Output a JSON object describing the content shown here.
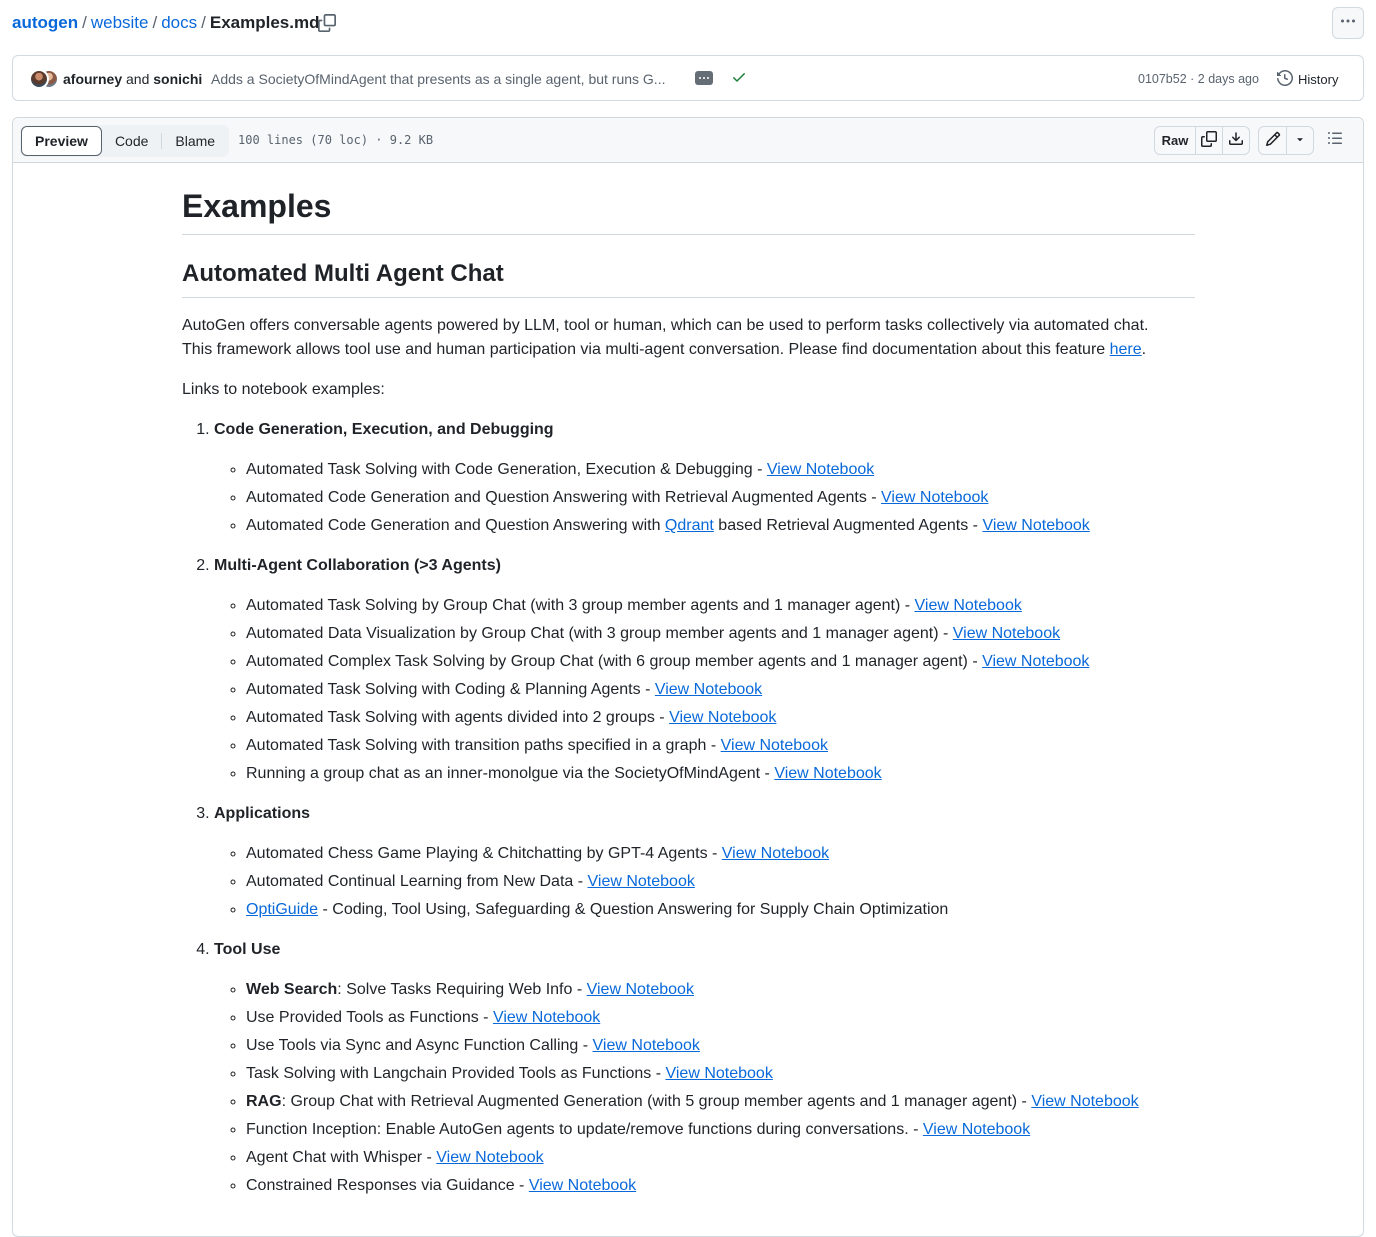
{
  "breadcrumb": {
    "root": "autogen",
    "parts": [
      "website",
      "docs"
    ],
    "separator": "/",
    "file": "Examples.md"
  },
  "icons": {
    "copy_path": "copy-icon",
    "more": "kebab-horizontal-icon",
    "check": "check-icon",
    "history": "history-icon",
    "copy_raw": "copy-icon",
    "download": "download-icon",
    "edit": "pencil-icon",
    "dropdown": "triangle-down-icon",
    "toc": "list-unordered-icon"
  },
  "colors": {
    "link": "#0969da",
    "text": "#1f2328",
    "muted": "#59636e",
    "border": "#d1d9e0",
    "success": "#1a7f37",
    "header_bg": "#f6f8fa"
  },
  "commit": {
    "author1": "afourney",
    "and": "and",
    "author2": "sonichi",
    "message": "Adds a SocietyOfMindAgent that presents as a single agent, but runs G...",
    "meta": "0107b52 · 2 days ago",
    "history_label": "History"
  },
  "file_header": {
    "tabs": [
      "Preview",
      "Code",
      "Blame"
    ],
    "active_tab": "Preview",
    "info": "100 lines (70 loc) · 9.2 KB",
    "raw_label": "Raw"
  },
  "doc": {
    "h1": "Examples",
    "h2": "Automated Multi Agent Chat",
    "intro_line1": "AutoGen offers conversable agents powered by LLM, tool or human, which can be used to perform tasks collectively via automated chat.",
    "intro_line2": "This framework allows tool use and human participation via multi-agent conversation. Please find documentation about this feature ",
    "intro_link": "here",
    "intro_end": ".",
    "links_intro": "Links to notebook examples:",
    "sections": [
      {
        "title": "Code Generation, Execution, and Debugging",
        "items": [
          {
            "text": "Automated Task Solving with Code Generation, Execution & Debugging - ",
            "link": "View Notebook"
          },
          {
            "text": "Automated Code Generation and Question Answering with Retrieval Augmented Agents - ",
            "link": "View Notebook"
          },
          {
            "pre": "Automated Code Generation and Question Answering with ",
            "inline_link": "Qdrant",
            "text": " based Retrieval Augmented Agents - ",
            "link": "View Notebook"
          }
        ]
      },
      {
        "title": "Multi-Agent Collaboration (>3 Agents)",
        "items": [
          {
            "text": "Automated Task Solving by Group Chat (with 3 group member agents and 1 manager agent) - ",
            "link": "View Notebook"
          },
          {
            "text": "Automated Data Visualization by Group Chat (with 3 group member agents and 1 manager agent) - ",
            "link": "View Notebook"
          },
          {
            "text": "Automated Complex Task Solving by Group Chat (with 6 group member agents and 1 manager agent) - ",
            "link": "View Notebook"
          },
          {
            "text": "Automated Task Solving with Coding & Planning Agents - ",
            "link": "View Notebook"
          },
          {
            "text": "Automated Task Solving with agents divided into 2 groups - ",
            "link": "View Notebook"
          },
          {
            "text": "Automated Task Solving with transition paths specified in a graph - ",
            "link": "View Notebook"
          },
          {
            "text": "Running a group chat as an inner-monolgue via the SocietyOfMindAgent - ",
            "link": "View Notebook"
          }
        ]
      },
      {
        "title": "Applications",
        "items": [
          {
            "text": "Automated Chess Game Playing & Chitchatting by GPT-4 Agents - ",
            "link": "View Notebook"
          },
          {
            "text": "Automated Continual Learning from New Data - ",
            "link": "View Notebook"
          },
          {
            "lead_link": "OptiGuide",
            "text": " - Coding, Tool Using, Safeguarding & Question Answering for Supply Chain Optimization"
          }
        ]
      },
      {
        "title": "Tool Use",
        "items": [
          {
            "bold": "Web Search",
            "text": ": Solve Tasks Requiring Web Info - ",
            "link": "View Notebook"
          },
          {
            "text": "Use Provided Tools as Functions - ",
            "link": "View Notebook"
          },
          {
            "text": "Use Tools via Sync and Async Function Calling - ",
            "link": "View Notebook"
          },
          {
            "text": "Task Solving with Langchain Provided Tools as Functions - ",
            "link": "View Notebook"
          },
          {
            "bold": "RAG",
            "text": ": Group Chat with Retrieval Augmented Generation (with 5 group member agents and 1 manager agent) - ",
            "link": "View Notebook"
          },
          {
            "text": "Function Inception: Enable AutoGen agents to update/remove functions during conversations. - ",
            "link": "View Notebook"
          },
          {
            "text": "Agent Chat with Whisper - ",
            "link": "View Notebook"
          },
          {
            "text": "Constrained Responses via Guidance - ",
            "link": "View Notebook"
          }
        ]
      }
    ]
  }
}
